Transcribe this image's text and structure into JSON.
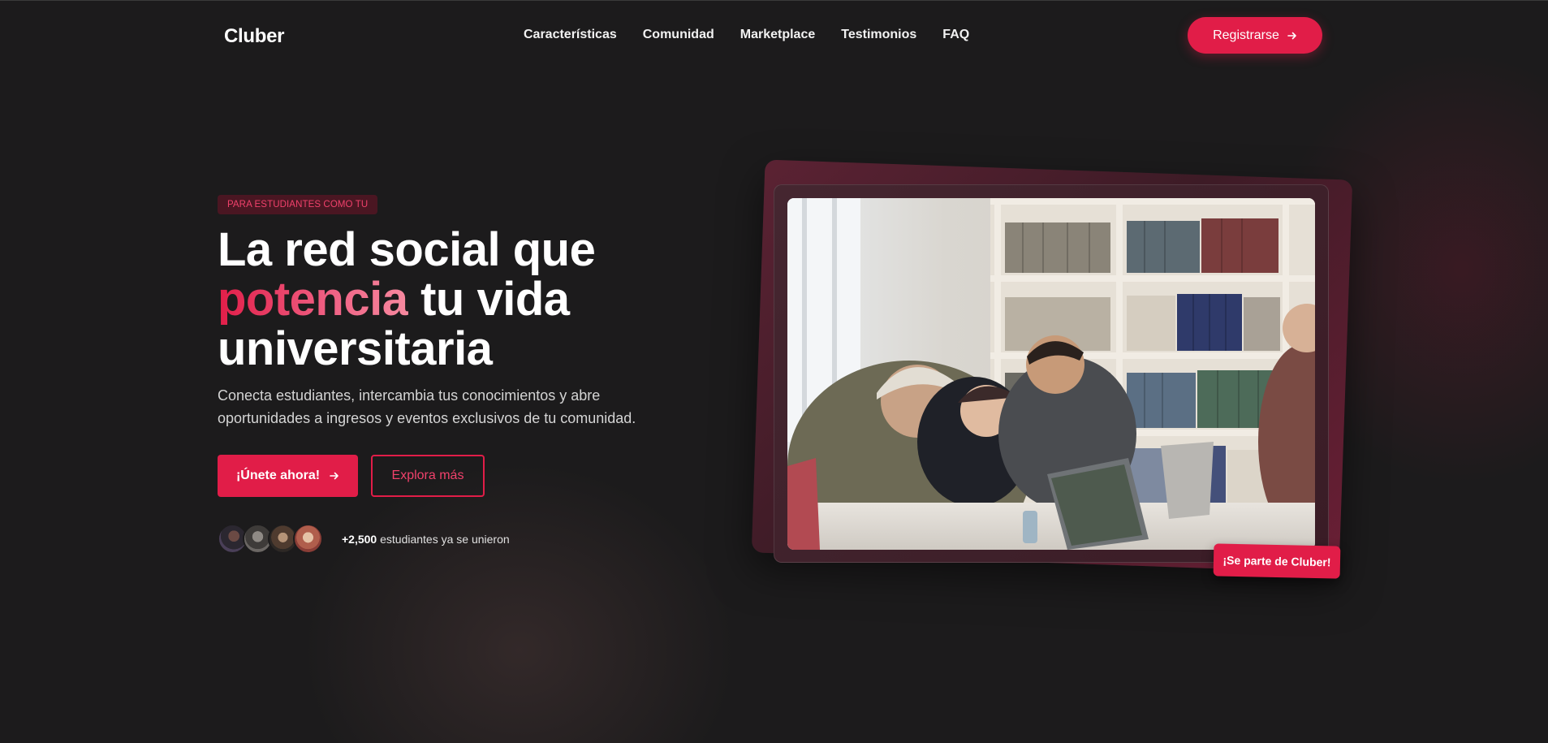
{
  "navbar": {
    "logo": "Cluber",
    "links": [
      "Características",
      "Comunidad",
      "Marketplace",
      "Testimonios",
      "FAQ"
    ],
    "register_label": "Registrarse",
    "register_icon": "arrow-right-icon"
  },
  "hero": {
    "tag": "PARA ESTUDIANTES COMO TU",
    "headline_part1": "La red social que",
    "headline_accent": "potencia",
    "headline_part2": " tu vida",
    "headline_part3": "universitaria",
    "subtitle": "Conecta estudiantes, intercambia tus conocimientos y abre oportunidades a ingresos y eventos exclusivos de tu comunidad.",
    "primary_button": "¡Únete ahora!",
    "secondary_button": "Explora más",
    "joined_count": "+2,500",
    "joined_text": " estudiantes ya se unieron",
    "badge": "¡Se parte de Cluber!"
  },
  "colors": {
    "background": "#1c1b1c",
    "accent": "#e11d48",
    "accent_light": "#f7899f",
    "tag_bg": "#4a1622"
  }
}
